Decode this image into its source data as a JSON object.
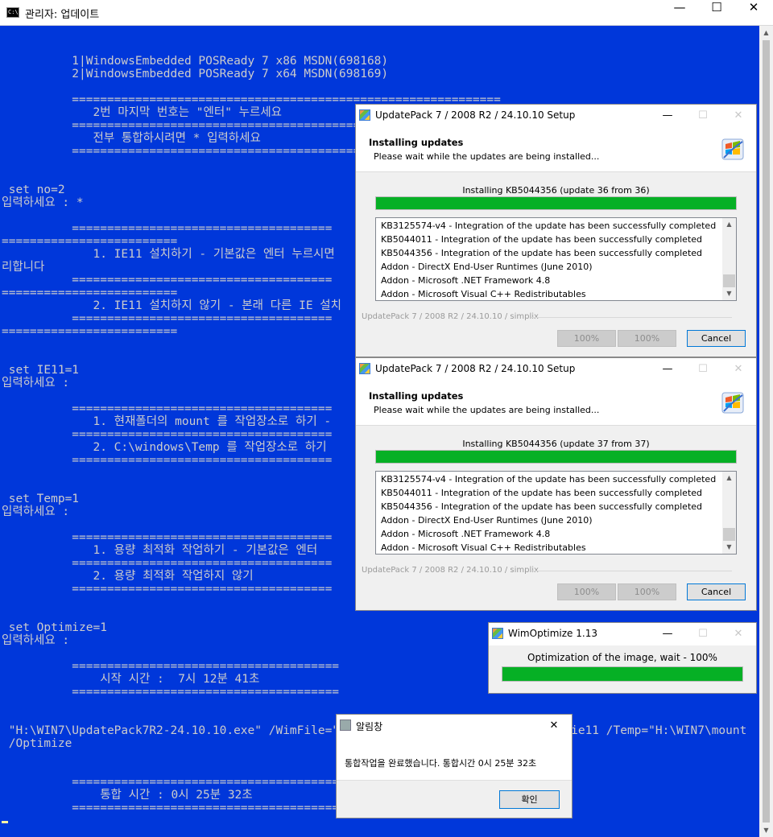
{
  "console": {
    "title": "관리자:  업데이트",
    "icon_label": "C:\\",
    "controls": {
      "minimize": "—",
      "maximize": "☐",
      "close": "✕"
    },
    "lines": [
      "",
      "",
      "          1|WindowsEmbedded POSReady 7 x86 MSDN(698168)",
      "          2|WindowsEmbedded POSReady 7 x64 MSDN(698169)",
      "",
      "          =============================================================",
      "             2번 마지막 번호는 \"엔터\" 누르세요",
      "          =============================================================",
      "             전부 통합하시려면 * 입력하세요",
      "          =============================================================",
      "",
      "",
      " set no=2",
      "입력하세요 : *",
      "",
      "          =====================================",
      "=========================",
      "             1. IE11 설치하기 - 기본값은 엔터 누르시면",
      "리합니다",
      "          =====================================",
      "=========================",
      "             2. IE11 설치하지 않기 - 본래 다른 IE 설치",
      "          =====================================",
      "=========================",
      "",
      "",
      " set IE11=1",
      "입력하세요 :",
      "",
      "          =====================================",
      "             1. 현재폴더의 mount 를 작업장소로 하기 -",
      "          =====================================",
      "             2. C:\\windows\\Temp 를 작업장소로 하기",
      "          =====================================",
      "",
      "",
      " set Temp=1",
      "입력하세요 :",
      "",
      "          =====================================",
      "             1. 용량 최적화 작업하기 - 기본값은 엔터",
      "          =====================================",
      "             2. 용량 최적화 작업하지 않기",
      "          =====================================",
      "",
      "",
      " set Optimize=1",
      "입력하세요 :",
      "",
      "          ======================================",
      "              시작 시간 :  7시 12분 41초",
      "          ======================================",
      "",
      "",
      " \"H:\\WIN7\\UpdatePack7R2-24.10.10.exe\" /WimFile=\"H:\\W                          * /ie11 /Temp=\"H:\\WIN7\\mount",
      " /Optimize",
      "",
      "",
      "          ======================================",
      "              통합 시간 : 0시 25분 32초",
      "          ======================================"
    ]
  },
  "updatepack_dialogs": [
    {
      "title": "UpdatePack 7 / 2008 R2 / 24.10.10 Setup",
      "header_title": "Installing updates",
      "header_subtitle": "Please wait while the updates are being installed...",
      "status": "Installing KB5044356 (update 36 from 36)",
      "progress": 1.0,
      "log": [
        "KB3125574-v4 - Integration of the update has been successfully completed",
        "KB5044011 - Integration of the update has been successfully completed",
        "KB5044356 - Integration of the update has been successfully completed",
        "Addon - DirectX End-User Runtimes (June 2010)",
        "Addon - Microsoft .NET Framework 4.8",
        "Addon - Microsoft Visual C++ Redistributables"
      ],
      "brand": "UpdatePack 7 / 2008 R2 / 24.10.10 / simplix",
      "btn_pct1": "100%",
      "btn_pct2": "100%",
      "cancel": "Cancel"
    },
    {
      "title": "UpdatePack 7 / 2008 R2 / 24.10.10 Setup",
      "header_title": "Installing updates",
      "header_subtitle": "Please wait while the updates are being installed...",
      "status": "Installing KB5044356 (update 37 from 37)",
      "progress": 1.0,
      "log": [
        "KB3125574-v4 - Integration of the update has been successfully completed",
        "KB5044011 - Integration of the update has been successfully completed",
        "KB5044356 - Integration of the update has been successfully completed",
        "Addon - DirectX End-User Runtimes (June 2010)",
        "Addon - Microsoft .NET Framework 4.8",
        "Addon - Microsoft Visual C++ Redistributables"
      ],
      "brand": "UpdatePack 7 / 2008 R2 / 24.10.10 / simplix",
      "btn_pct1": "100%",
      "btn_pct2": "100%",
      "cancel": "Cancel"
    }
  ],
  "wimoptimize": {
    "title": "WimOptimize 1.13",
    "status": "Optimization of the image, wait - 100%",
    "progress": 1.0
  },
  "alert": {
    "title": "알림창",
    "message": "통합작업을 완료했습니다. 통합시간 0시 25분 32초",
    "ok": "확인"
  },
  "colors": {
    "console_bg": "#0037da",
    "console_text": "#cccccc",
    "progress_green": "#06b025",
    "cursor": "#f9f1a5"
  },
  "icons": {
    "console": "cmd-icon",
    "installer": "windows-flag-icon"
  }
}
